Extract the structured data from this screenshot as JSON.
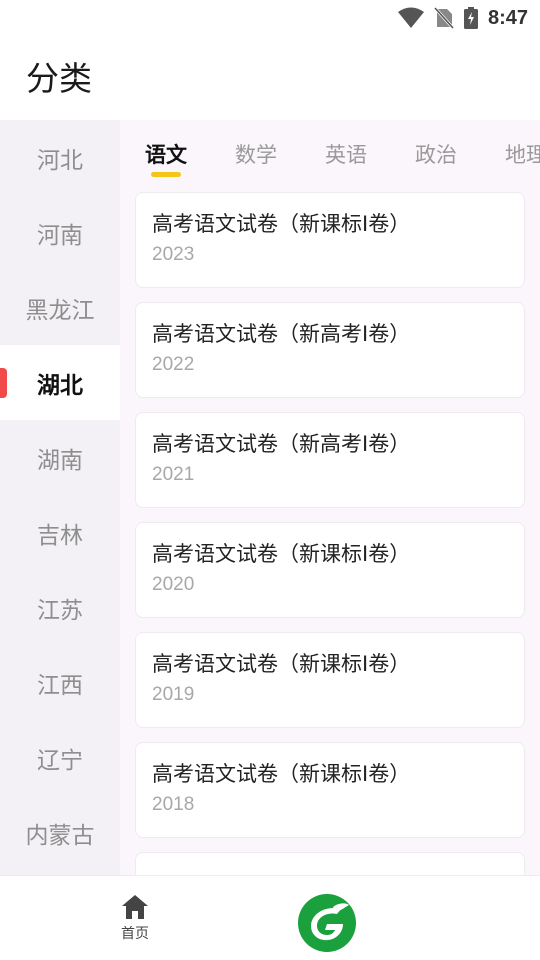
{
  "status_bar": {
    "time": "8:47"
  },
  "header": {
    "title": "分类"
  },
  "sidebar": {
    "items": [
      {
        "label": "河北",
        "active": false
      },
      {
        "label": "河南",
        "active": false
      },
      {
        "label": "黑龙江",
        "active": false
      },
      {
        "label": "湖北",
        "active": true
      },
      {
        "label": "湖南",
        "active": false
      },
      {
        "label": "吉林",
        "active": false
      },
      {
        "label": "江苏",
        "active": false
      },
      {
        "label": "江西",
        "active": false
      },
      {
        "label": "辽宁",
        "active": false
      },
      {
        "label": "内蒙古",
        "active": false
      }
    ]
  },
  "tabs": [
    {
      "label": "语文",
      "active": true
    },
    {
      "label": "数学",
      "active": false
    },
    {
      "label": "英语",
      "active": false
    },
    {
      "label": "政治",
      "active": false
    },
    {
      "label": "地理",
      "active": false
    }
  ],
  "papers": [
    {
      "title": "高考语文试卷（新课标Ⅰ卷）",
      "year": "2023"
    },
    {
      "title": "高考语文试卷（新高考Ⅰ卷）",
      "year": "2022"
    },
    {
      "title": "高考语文试卷（新高考Ⅰ卷）",
      "year": "2021"
    },
    {
      "title": "高考语文试卷（新课标Ⅰ卷）",
      "year": "2020"
    },
    {
      "title": "高考语文试卷（新课标Ⅰ卷）",
      "year": "2019"
    },
    {
      "title": "高考语文试卷（新课标Ⅰ卷）",
      "year": "2018"
    },
    {
      "title": "",
      "year": ""
    }
  ],
  "bottom_nav": {
    "home_label": "首页",
    "home_icon": "home-icon",
    "center_icon": "app-logo-icon"
  },
  "colors": {
    "accent_red": "#f04a4a",
    "tab_underline": "#f5c518",
    "logo_green": "#1aa03c"
  }
}
